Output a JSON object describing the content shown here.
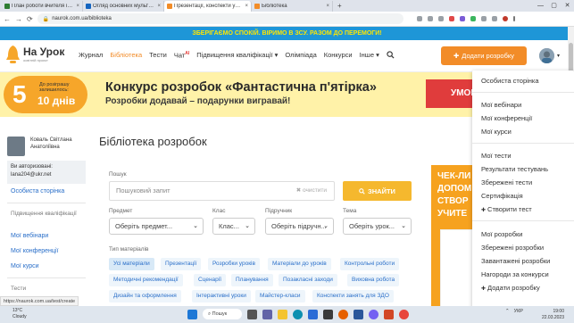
{
  "browser": {
    "tabs": [
      {
        "label": "План роботи вчителя інф. біол.",
        "color": "#2e7d32",
        "active": false
      },
      {
        "label": "Огляд основних мультимедійних",
        "color": "#1565c0",
        "active": false
      },
      {
        "label": "Презентації, конспекти уроків",
        "color": "#f28c28",
        "active": true
      },
      {
        "label": "Бібліотека",
        "color": "#f28c28",
        "active": false
      }
    ],
    "close_glyph": "×",
    "new_tab_glyph": "+",
    "window_controls": [
      "—",
      "▢",
      "✕"
    ],
    "url": "naurok.com.ua/biblioteka",
    "nav_glyphs": [
      "←",
      "→",
      "⟳"
    ]
  },
  "banner": {
    "text": "ЗБЕРІГАЄМО СПОКІЙ. ВІРИМО В ЗСУ. РАЗОМ ДО ПЕРЕМОГИ!"
  },
  "header": {
    "logo_title": "На Урок",
    "logo_sub": "освітній проєкт",
    "nav": [
      {
        "label": "Журнал",
        "active": false
      },
      {
        "label": "Бібліотека",
        "active": true
      },
      {
        "label": "Тести",
        "active": false
      },
      {
        "label": "Чат",
        "sup": "AI",
        "active": false
      },
      {
        "label": "Підвищення кваліфікації ▾",
        "active": false
      },
      {
        "label": "Олімпіада",
        "active": false
      },
      {
        "label": "Конкурси",
        "active": false
      },
      {
        "label": "Інше ▾",
        "active": false
      }
    ],
    "add_button": "Додати розробку",
    "avatar_caret": "▾"
  },
  "promo": {
    "number": "5",
    "label": "До розіграшу залишилось:",
    "days": "10 днів",
    "title": "Конкурс розробок «Фантастична п'ятірка»",
    "subtitle": "Розробки додавай – подарунки вигравай!",
    "button": "УМОВИ"
  },
  "sidebar": {
    "name": "Коваль Світлана Анатоліївна",
    "auth_label": "Ви авторизовані:",
    "auth_email": "lana204@ukr.net",
    "own_page": "Особиста сторінка",
    "section": "Підвищення кваліфікації",
    "links": [
      "Мої вебінари",
      "Мої конференції",
      "Мої курси"
    ],
    "tests_label": "Тести"
  },
  "main": {
    "title": "Бібліотека розробок",
    "search_label": "Пошук",
    "search_placeholder": "Пошуковий запит",
    "clear_label": "очистити",
    "find_button": "ЗНАЙТИ",
    "filters": [
      {
        "label": "Предмет",
        "value": "Оберіть предмет..."
      },
      {
        "label": "Клас",
        "value": "Клас..."
      },
      {
        "label": "Підручник",
        "value": "Оберіть підручн..."
      },
      {
        "label": "Тема",
        "value": "Оберіть урок..."
      }
    ],
    "material_label": "Тип матеріалів",
    "chips": [
      {
        "label": "Усі матеріали",
        "on": true
      },
      {
        "label": "Презентації",
        "on": false
      },
      {
        "label": "Розробки уроків",
        "on": false
      },
      {
        "label": "Матеріали до уроків",
        "on": false
      },
      {
        "label": "Контрольні роботи",
        "on": false
      },
      {
        "label": "Методичні рекомендації",
        "on": false
      },
      {
        "label": "Сценарії",
        "on": false
      },
      {
        "label": "Планування",
        "on": false
      },
      {
        "label": "Позакласні заходи",
        "on": false
      },
      {
        "label": "Виховна робота",
        "on": false
      },
      {
        "label": "Дизайн та оформлення",
        "on": false
      },
      {
        "label": "Інтерактивні уроки",
        "on": false
      },
      {
        "label": "Майстер-класи",
        "on": false
      },
      {
        "label": "Конспекти занять для ЗДО",
        "on": false
      }
    ]
  },
  "right_card": {
    "text_lines": [
      "ЧЕК-ЛИ",
      "ДОПОМ",
      "СТВОР",
      "УЧИТЕ"
    ]
  },
  "dropdown_menu": {
    "items": [
      {
        "label": "Особиста сторінка",
        "plus": false
      },
      {
        "label": "Мої вебінари",
        "plus": false
      },
      {
        "label": "Мої конференції",
        "plus": false
      },
      {
        "label": "Мої курси",
        "plus": false
      },
      {
        "label": "Мої тести",
        "plus": false
      },
      {
        "label": "Результати тестувань",
        "plus": false
      },
      {
        "label": "Збережені тести",
        "plus": false
      },
      {
        "label": "Сертифікація",
        "plus": false
      },
      {
        "label": "Створити тест",
        "plus": true
      },
      {
        "label": "Мої розробки",
        "plus": false
      },
      {
        "label": "Збережені розробки",
        "plus": false
      },
      {
        "label": "Завантажені розробки",
        "plus": false
      },
      {
        "label": "Нагороди за конкурси",
        "plus": false
      },
      {
        "label": "Додати розробку",
        "plus": true
      }
    ]
  },
  "status_url": "https://naurok.com.ua/test/create",
  "taskbar": {
    "temperature": "13°C",
    "weather": "Cloudy",
    "search": "Пошук",
    "lang": "УКР",
    "time": "19:00",
    "date": "22.03.2023"
  },
  "colors": {
    "accent": "#f28c28",
    "banner_bg": "#1e96d7",
    "banner_text": "#ffe600",
    "promo_bg": "#fff2a8",
    "promo_btn": "#e03c3c",
    "find_btn": "#f5b82e",
    "link": "#2a6fc9"
  }
}
